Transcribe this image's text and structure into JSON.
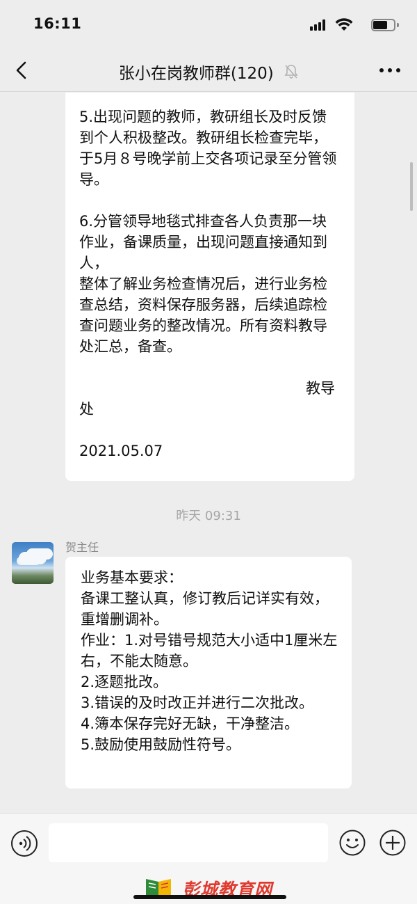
{
  "status_bar": {
    "time": "16:11"
  },
  "nav": {
    "title": "张小在岗教师群(120)"
  },
  "chat": {
    "messages": [
      {
        "paragraphs": [
          "5.出现问题的教师，教研组长及时反馈到个人积极整改。教研组长检查完毕，于5月８号晚学前上交各项记录至分管领导。",
          "6.分管领导地毯式排查各人负责那一块作业，备课质量，出现问题直接通知到人，\n整体了解业务检查情况后，进行业务检查总结，资料保存服务器，后续追踪检查问题业务的整改情况。所有资料教导处汇总，备查。"
        ],
        "sign_part1": "教导",
        "sign_part2": "处",
        "date": "2021.05.07"
      }
    ],
    "timestamp": "昨天 09:31",
    "sender_name": "贺主任",
    "message2_text": "业务基本要求：\n备课工整认真，修订教后记详实有效，重增删调补。\n作业：1.对号错号规范大小适中1厘米左右，不能太随意。\n2.逐题批改。\n3.错误的及时改正并进行二次批改。\n4.簿本保存完好无缺，干净整洁。\n5.鼓励使用鼓励性符号。"
  },
  "input_bar": {
    "value": "",
    "placeholder": ""
  },
  "watermark": {
    "text": "彭城教育网"
  },
  "colors": {
    "background": "#ededed",
    "bubble": "#ffffff",
    "timestamp": "#a6a6a6",
    "watermark": "#e03a2f"
  },
  "icons": [
    "back-icon",
    "mute-icon",
    "more-icon",
    "voice-icon",
    "emoji-icon",
    "plus-icon"
  ]
}
